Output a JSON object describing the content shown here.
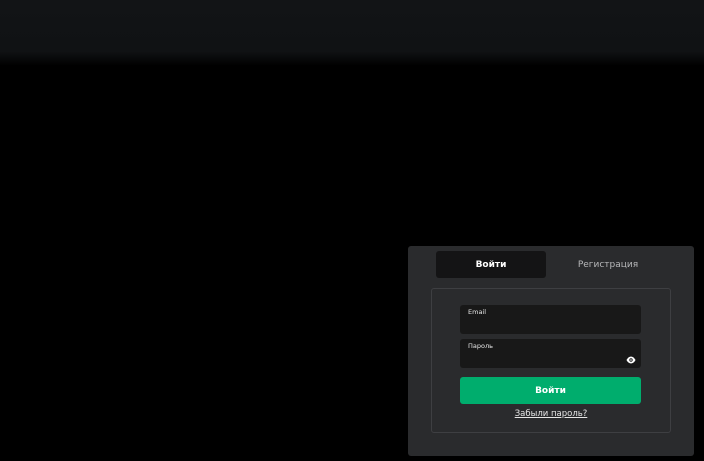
{
  "auth": {
    "tabs": [
      {
        "label": "Войти",
        "active": true
      },
      {
        "label": "Регистрация",
        "active": false
      }
    ],
    "email": {
      "label": "Email",
      "value": ""
    },
    "password": {
      "label": "Пароль",
      "value": ""
    },
    "submit_label": "Войти",
    "forgot_label": "Забыли пароль?",
    "icons": {
      "password_toggle": "eye-icon"
    }
  },
  "colors": {
    "page_background": "#000000",
    "header_background": "#111315",
    "panel_background": "#2a2b2d",
    "active_tab_background": "#141415",
    "input_background": "#181818",
    "accent": "#00ad6d"
  }
}
